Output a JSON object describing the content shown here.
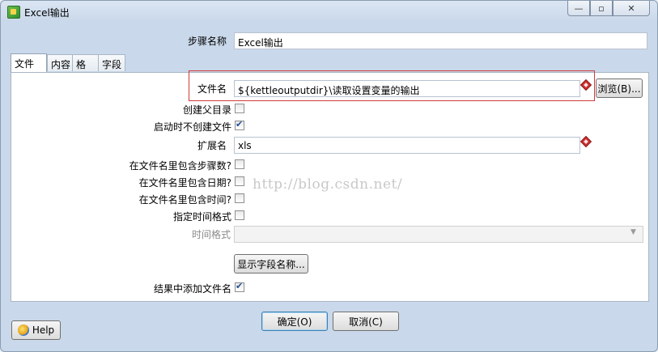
{
  "window": {
    "title": "Excel输出",
    "min_symbol": "—",
    "max_symbol": "▫",
    "close_symbol": "✕"
  },
  "step": {
    "label": "步骤名称",
    "value": "Excel输出"
  },
  "tabs": [
    {
      "label": "文件",
      "active": true
    },
    {
      "label": "内容",
      "active": false
    },
    {
      "label": "格式",
      "active": false
    },
    {
      "label": "字段",
      "active": false
    }
  ],
  "file": {
    "filename_label": "文件名",
    "filename_value": "${kettleoutputdir}\\读取设置变量的输出",
    "browse_label": "浏览(B)...",
    "create_parent_label": "创建父目录",
    "create_parent_checked": false,
    "no_create_on_start_label": "启动时不创建文件",
    "no_create_on_start_checked": true,
    "extension_label": "扩展名",
    "extension_value": "xls",
    "include_stepnr_label": "在文件名里包含步骤数?",
    "include_stepnr_checked": false,
    "include_date_label": "在文件名里包含日期?",
    "include_date_checked": false,
    "include_time_label": "在文件名里包含时间?",
    "include_time_checked": false,
    "specify_format_label": "指定时间格式",
    "specify_format_checked": false,
    "time_format_label": "时间格式",
    "time_format_value": "",
    "show_fields_label": "显示字段名称...",
    "add_to_result_label": "结果中添加文件名",
    "add_to_result_checked": true
  },
  "watermark": "http://blog.csdn.net/",
  "buttons": {
    "ok": "确定(O)",
    "cancel": "取消(C)",
    "help": "Help"
  },
  "icons": {
    "app": "spoon-app-icon",
    "variable": "variable-diamond-icon",
    "help": "help-globe-icon",
    "dropdown": "chevron-down-icon"
  },
  "colors": {
    "highlight_box": "#d03a3a",
    "variable_icon": "#d03030",
    "checkmark": "#1e4e9a"
  }
}
